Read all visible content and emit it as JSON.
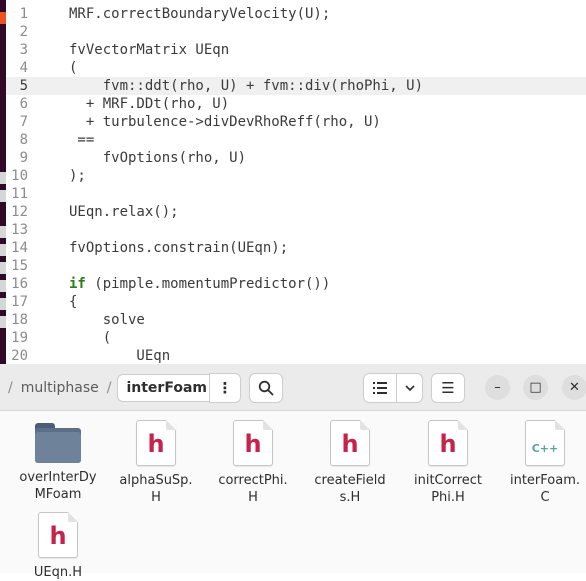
{
  "editor": {
    "lines": [
      {
        "n": "1",
        "text": "MRF.correctBoundaryVelocity(U);",
        "current": false
      },
      {
        "n": "2",
        "text": "",
        "current": false
      },
      {
        "n": "3",
        "text": "fvVectorMatrix UEqn",
        "current": false
      },
      {
        "n": "4",
        "text": "(",
        "current": false
      },
      {
        "n": "5",
        "text": "    fvm::ddt(rho, U) + fvm::div(rhoPhi, U)",
        "current": true
      },
      {
        "n": "6",
        "text": "  + MRF.DDt(rho, U)",
        "current": false
      },
      {
        "n": "7",
        "text": "  + turbulence->divDevRhoReff(rho, U)",
        "current": false
      },
      {
        "n": "8",
        "text": " ==",
        "current": false
      },
      {
        "n": "9",
        "text": "    fvOptions(rho, U)",
        "current": false
      },
      {
        "n": "10",
        "text": ");",
        "current": false
      },
      {
        "n": "11",
        "text": "",
        "current": false
      },
      {
        "n": "12",
        "text": "UEqn.relax();",
        "current": false
      },
      {
        "n": "13",
        "text": "",
        "current": false
      },
      {
        "n": "14",
        "text": "fvOptions.constrain(UEqn);",
        "current": false
      },
      {
        "n": "15",
        "text": "",
        "current": false
      },
      {
        "n": "16",
        "kw": "if",
        "text": " (pimple.momentumPredictor())",
        "current": false
      },
      {
        "n": "17",
        "text": "{",
        "current": false
      },
      {
        "n": "18",
        "text": "    solve",
        "current": false
      },
      {
        "n": "19",
        "text": "    (",
        "current": false
      },
      {
        "n": "20",
        "text": "        UEqn",
        "current": false
      }
    ]
  },
  "terminal": {
    "colors": {
      "bg": "#300a24",
      "accent": "#e95420"
    }
  },
  "filemanager": {
    "path": {
      "leading_sep": "/",
      "parent": "multiphase",
      "sep": "/",
      "current": "interFoam"
    },
    "buttons": {
      "menu": "⋮",
      "search": "search-icon",
      "view_list": "list-view-icon",
      "view_dropdown": "chevron-down-icon",
      "main_menu": "☰",
      "minimize": "–",
      "maximize": "□",
      "close": "✕"
    },
    "files": [
      {
        "name": "overInterDyMFoam",
        "label_lines": [
          "overInterDy",
          "MFoam"
        ],
        "type": "folder"
      },
      {
        "name": "alphaSuSp.H",
        "label_lines": [
          "alphaSuSp.",
          "H"
        ],
        "type": "header",
        "glyph": "h"
      },
      {
        "name": "correctPhi.H",
        "label_lines": [
          "correctPhi.",
          "H"
        ],
        "type": "header",
        "glyph": "h"
      },
      {
        "name": "createFields.H",
        "label_lines": [
          "createField",
          "s.H"
        ],
        "type": "header",
        "glyph": "h"
      },
      {
        "name": "initCorrectPhi.H",
        "label_lines": [
          "initCorrect",
          "Phi.H"
        ],
        "type": "header",
        "glyph": "h"
      },
      {
        "name": "interFoam.C",
        "label_lines": [
          "interFoam.",
          "C"
        ],
        "type": "cpp",
        "glyph": "C++"
      },
      {
        "name": "UEqn.H",
        "label_lines": [
          "UEqn.H"
        ],
        "type": "header",
        "glyph": "h"
      }
    ]
  }
}
